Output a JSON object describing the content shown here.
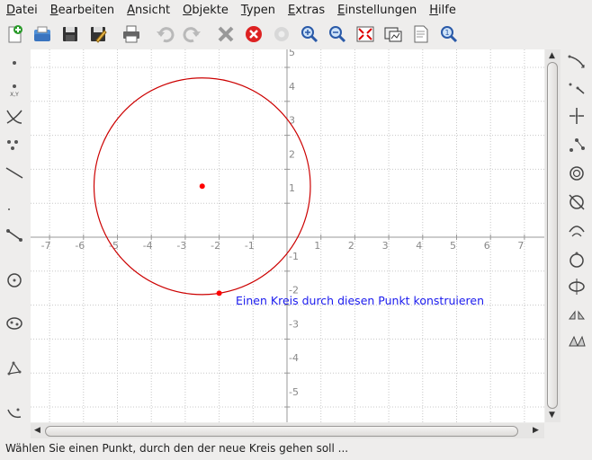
{
  "menu": [
    "Datei",
    "Bearbeiten",
    "Ansicht",
    "Objekte",
    "Typen",
    "Extras",
    "Einstellungen",
    "Hilfe"
  ],
  "toolbar_icons": [
    "new-document-icon",
    "open-folder-icon",
    "save-icon",
    "save-as-icon",
    "print-icon",
    "undo-icon",
    "redo-icon",
    "delete-icon",
    "cancel-icon",
    "settings-icon",
    "zoom-in-icon",
    "zoom-out-icon",
    "fit-to-screen-icon",
    "export-icon",
    "page-icon",
    "zoom-fit-icon"
  ],
  "canvas": {
    "x_ticks": [
      "-7",
      "-6",
      "-5",
      "-4",
      "-3",
      "-2",
      "-1",
      "1",
      "2",
      "3",
      "4",
      "5",
      "6",
      "7"
    ],
    "y_ticks": [
      "5",
      "4",
      "3",
      "2",
      "1",
      "-1",
      "-2",
      "-3",
      "-4",
      "-5"
    ],
    "circle_center": [
      -2.5,
      1.5
    ],
    "circle_through_point": [
      -2.0,
      -1.65
    ],
    "hint": "Einen Kreis durch diesen Punkt konstruieren",
    "colors": {
      "circle": "#cc0000",
      "point": "#ff0000",
      "grid": "#c8c8c8",
      "axis": "#999999",
      "hint": "#1a1aee"
    }
  },
  "status": "Wählen Sie einen Punkt, durch den der neue Kreis gehen soll ..."
}
